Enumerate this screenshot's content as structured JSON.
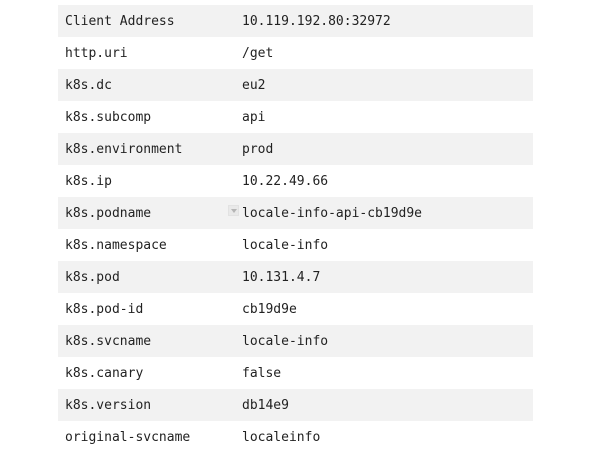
{
  "rows": [
    {
      "key": "Client Address",
      "value": "10.119.192.80:32972"
    },
    {
      "key": "http.uri",
      "value": "/get"
    },
    {
      "key": "k8s.dc",
      "value": "eu2"
    },
    {
      "key": "k8s.subcomp",
      "value": "api"
    },
    {
      "key": "k8s.environment",
      "value": "prod"
    },
    {
      "key": "k8s.ip",
      "value": "10.22.49.66"
    },
    {
      "key": "k8s.podname",
      "value": "locale-info-api-cb19d9e"
    },
    {
      "key": "k8s.namespace",
      "value": "locale-info"
    },
    {
      "key": "k8s.pod",
      "value": "10.131.4.7"
    },
    {
      "key": "k8s.pod-id",
      "value": "cb19d9e"
    },
    {
      "key": "k8s.svcname",
      "value": "locale-info"
    },
    {
      "key": "k8s.canary",
      "value": "false"
    },
    {
      "key": "k8s.version",
      "value": "db14e9"
    },
    {
      "key": "original-svcname",
      "value": "localeinfo"
    }
  ],
  "hover_icon": "chevron-down-icon"
}
